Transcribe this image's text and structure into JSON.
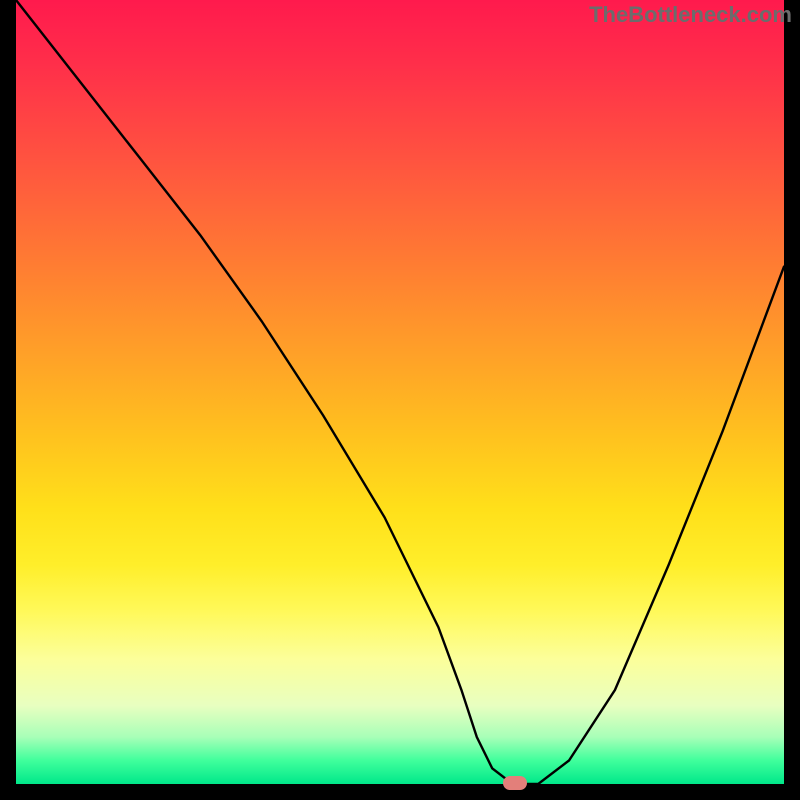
{
  "watermark": "TheBottleneck.com",
  "chart_data": {
    "type": "line",
    "title": "",
    "xlabel": "",
    "ylabel": "",
    "xlim": [
      0,
      100
    ],
    "ylim": [
      0,
      100
    ],
    "series": [
      {
        "name": "curve",
        "x": [
          0,
          8,
          16,
          24,
          32,
          40,
          48,
          55,
          58,
          60,
          62,
          64,
          65,
          68,
          72,
          78,
          85,
          92,
          100
        ],
        "values": [
          100,
          90,
          80,
          70,
          59,
          47,
          34,
          20,
          12,
          6,
          2,
          0.5,
          0,
          0,
          3,
          12,
          28,
          45,
          66
        ]
      }
    ],
    "marker": {
      "x": 65,
      "y": 0,
      "color": "#e37f7a"
    },
    "gradient_note": "vertical red→green background indicating quality; curve dips to green at optimum"
  }
}
